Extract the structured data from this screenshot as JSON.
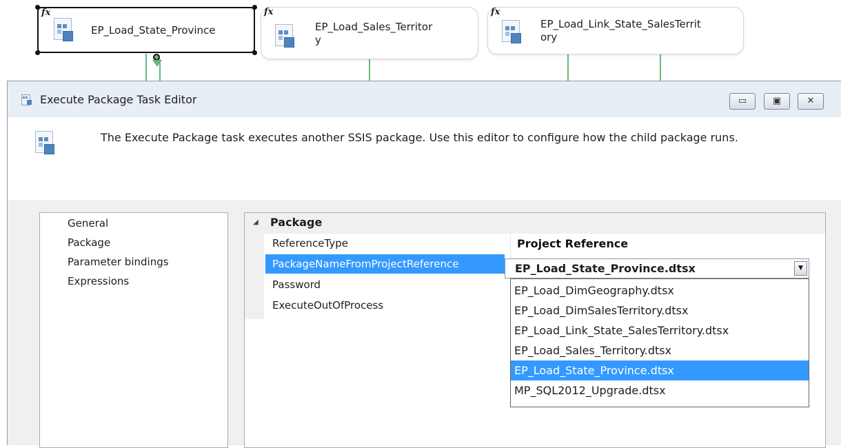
{
  "canvas": {
    "tasks": [
      {
        "name": "EP_Load_State_Province"
      },
      {
        "name_line1": "EP_Load_Sales_Territor",
        "name_line2": "y"
      },
      {
        "name_line1": "EP_Load_Link_State_SalesTerrit",
        "name_line2": "ory"
      }
    ],
    "fx_glyph": "fx",
    "icon": "package-icon"
  },
  "editor": {
    "title": "Execute Package Task Editor",
    "description": "The Execute Package task executes another SSIS package. Use this editor to configure how the child package runs.",
    "window_buttons": {
      "minimize": "▭",
      "restore": "▣",
      "close": "✕"
    },
    "nav": [
      "General",
      "Package",
      "Parameter bindings",
      "Expressions"
    ],
    "properties": {
      "category": "Package",
      "toggle": "◢",
      "rows": [
        {
          "name": "ReferenceType",
          "value": "Project Reference"
        },
        {
          "name": "PackageNameFromProjectReference",
          "value": "EP_Load_State_Province.dtsx"
        },
        {
          "name": "Password",
          "value": ""
        },
        {
          "name": "ExecuteOutOfProcess",
          "value": ""
        }
      ]
    },
    "combo": {
      "value": "EP_Load_State_Province.dtsx",
      "arrow": "▼",
      "options": [
        "EP_Load_DimGeography.dtsx",
        "EP_Load_DimSalesTerritory.dtsx",
        "EP_Load_Link_State_SalesTerritory.dtsx",
        "EP_Load_Sales_Territory.dtsx",
        "EP_Load_State_Province.dtsx",
        "MP_SQL2012_Upgrade.dtsx"
      ],
      "selected_index": 4
    }
  },
  "colors": {
    "selection": "#3399ff",
    "connector": "#69b67f",
    "titlebar": "#e8eef6"
  }
}
